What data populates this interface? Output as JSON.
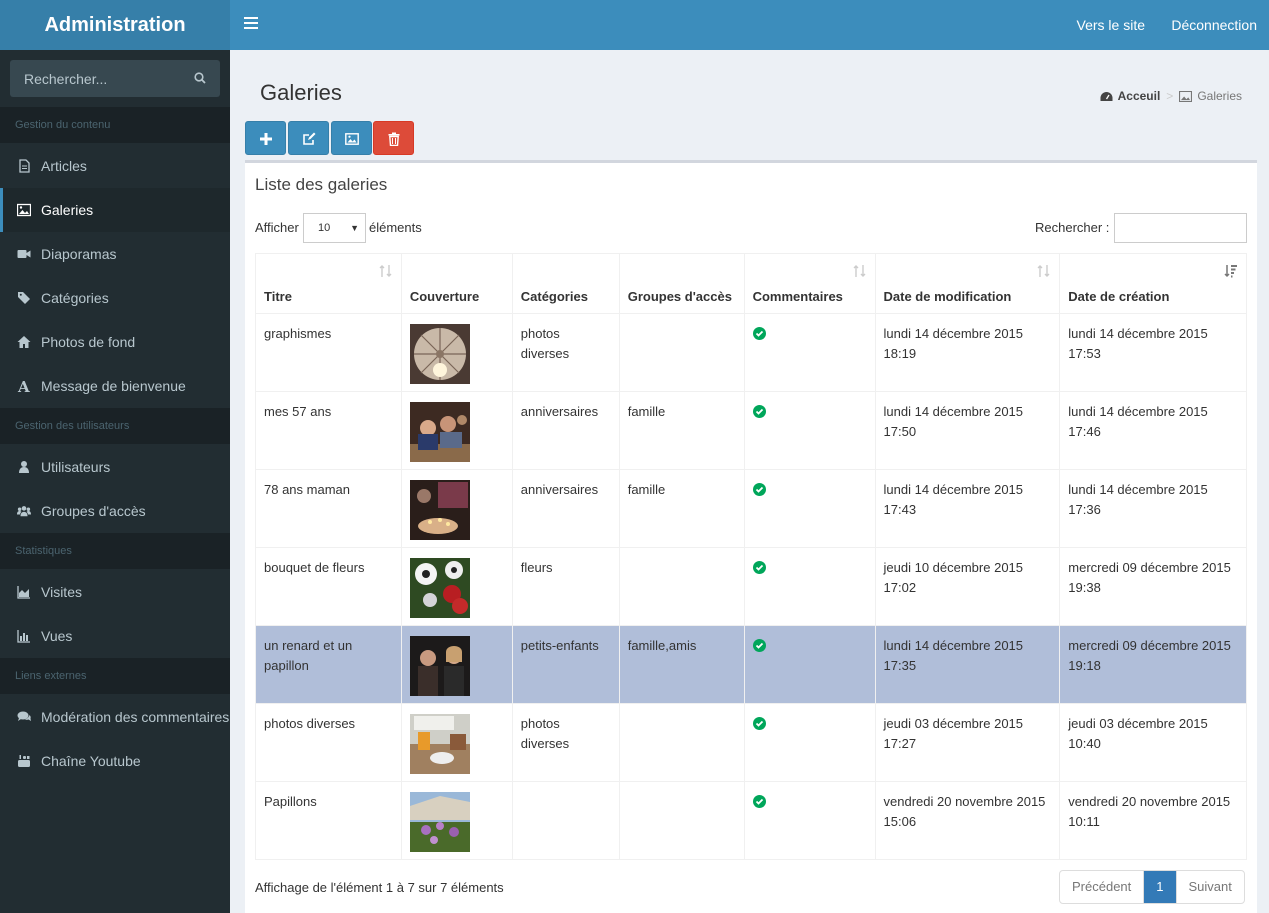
{
  "app": {
    "title": "Administration"
  },
  "topbar": {
    "site_link": "Vers le site",
    "logout_link": "Déconnection"
  },
  "sidebar": {
    "search_placeholder": "Rechercher...",
    "sections": [
      {
        "header": "Gestion du contenu",
        "items": [
          {
            "label": "Articles",
            "icon": "file-icon"
          },
          {
            "label": "Galeries",
            "icon": "image-icon",
            "active": true
          },
          {
            "label": "Diaporamas",
            "icon": "video-icon"
          },
          {
            "label": "Catégories",
            "icon": "tags-icon"
          },
          {
            "label": "Photos de fond",
            "icon": "home-icon"
          },
          {
            "label": "Message de bienvenue",
            "icon": "font-icon"
          }
        ]
      },
      {
        "header": "Gestion des utilisateurs",
        "items": [
          {
            "label": "Utilisateurs",
            "icon": "user-icon"
          },
          {
            "label": "Groupes d'accès",
            "icon": "users-icon"
          }
        ]
      },
      {
        "header": "Statistiques",
        "items": [
          {
            "label": "Visites",
            "icon": "area-chart-icon"
          },
          {
            "label": "Vues",
            "icon": "bar-chart-icon"
          }
        ]
      },
      {
        "header": "Liens externes",
        "items": [
          {
            "label": "Modération des commentaires",
            "icon": "comments-icon"
          },
          {
            "label": "Chaîne Youtube",
            "icon": "youtube-icon"
          }
        ]
      }
    ]
  },
  "page": {
    "title": "Galeries",
    "breadcrumb": {
      "home": "Acceuil",
      "current": "Galeries"
    }
  },
  "toolbar": {
    "icons": [
      "plus-icon",
      "edit-icon",
      "picture-icon",
      "trash-icon"
    ]
  },
  "box": {
    "title": "Liste des galeries",
    "length_prefix": "Afficher",
    "length_value": "10",
    "length_suffix": "éléments",
    "search_label": "Rechercher :"
  },
  "table": {
    "columns": [
      "Titre",
      "Couverture",
      "Catégories",
      "Groupes d'accès",
      "Commentaires",
      "Date de modification",
      "Date de création"
    ],
    "rows": [
      {
        "title": "graphismes",
        "categories": "photos diverses",
        "groups": "",
        "comments": true,
        "modified": "lundi 14 décembre 2015 18:19",
        "created": "lundi 14 décembre 2015 17:53"
      },
      {
        "title": "mes 57 ans",
        "categories": "anniversaires",
        "groups": "famille",
        "comments": true,
        "modified": "lundi 14 décembre 2015 17:50",
        "created": "lundi 14 décembre 2015 17:46"
      },
      {
        "title": "78 ans maman",
        "categories": "anniversaires",
        "groups": "famille",
        "comments": true,
        "modified": "lundi 14 décembre 2015 17:43",
        "created": "lundi 14 décembre 2015 17:36"
      },
      {
        "title": "bouquet de fleurs",
        "categories": "fleurs",
        "groups": "",
        "comments": true,
        "modified": "jeudi 10 décembre 2015 17:02",
        "created": "mercredi 09 décembre 2015 19:38"
      },
      {
        "title": "un renard et un papillon",
        "categories": "petits-enfants",
        "groups": "famille,amis",
        "comments": true,
        "modified": "lundi 14 décembre 2015 17:35",
        "created": "mercredi 09 décembre 2015 19:18",
        "selected": true
      },
      {
        "title": "photos diverses",
        "categories": "photos diverses",
        "groups": "",
        "comments": true,
        "modified": "jeudi 03 décembre 2015 17:27",
        "created": "jeudi 03 décembre 2015 10:40"
      },
      {
        "title": "Papillons",
        "categories": "",
        "groups": "",
        "comments": true,
        "modified": "vendredi 20 novembre 2015 15:06",
        "created": "vendredi 20 novembre 2015 10:11"
      }
    ]
  },
  "footer": {
    "info": "Affichage de l'élément 1 à 7 sur 7 éléments",
    "prev": "Précédent",
    "page": "1",
    "next": "Suivant"
  },
  "colors": {
    "header": "#3c8dbc",
    "logo": "#367fa9",
    "sidebar": "#222d32",
    "danger": "#dd4b39",
    "success": "#00a65a",
    "selected_row": "#b0bed9"
  }
}
